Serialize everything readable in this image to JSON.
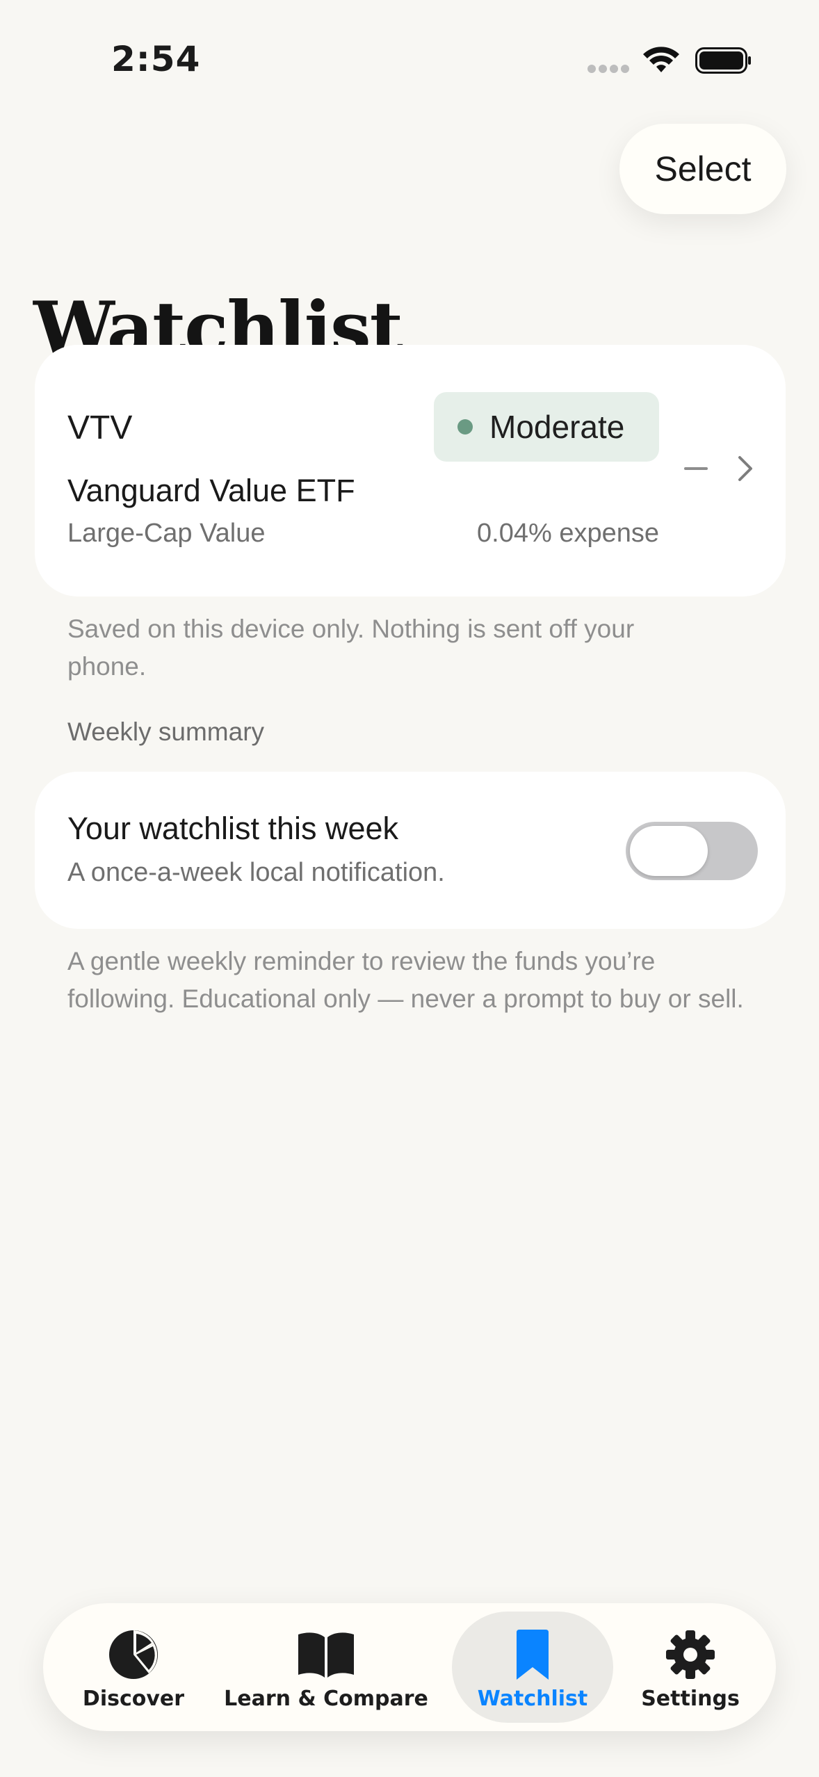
{
  "status_bar": {
    "time": "2:54"
  },
  "header": {
    "select_label": "Select",
    "title": "Watchlist"
  },
  "fund": {
    "ticker": "VTV",
    "risk_label": "Moderate",
    "name": "Vanguard Value ETF",
    "category": "Large-Cap Value",
    "expense": "0.04% expense"
  },
  "device_note": "Saved on this device only. Nothing is sent off your phone.",
  "weekly": {
    "section_label": "Weekly summary",
    "title": "Your watchlist this week",
    "subtitle": "A once-a-week local notification.",
    "toggle_on": false,
    "note": "A gentle weekly reminder to review the funds you’re following. Educational only — never a prompt to buy or sell."
  },
  "tabs": [
    {
      "label": "Discover",
      "icon": "pie-chart-icon"
    },
    {
      "label": "Learn & Compare",
      "icon": "book-icon"
    },
    {
      "label": "Watchlist",
      "icon": "bookmark-icon",
      "active": true
    },
    {
      "label": "Settings",
      "icon": "gear-icon"
    }
  ],
  "colors": {
    "accent": "#0a84ff",
    "chip_bg": "#e6efe9",
    "chip_dot": "#6a9a83"
  }
}
